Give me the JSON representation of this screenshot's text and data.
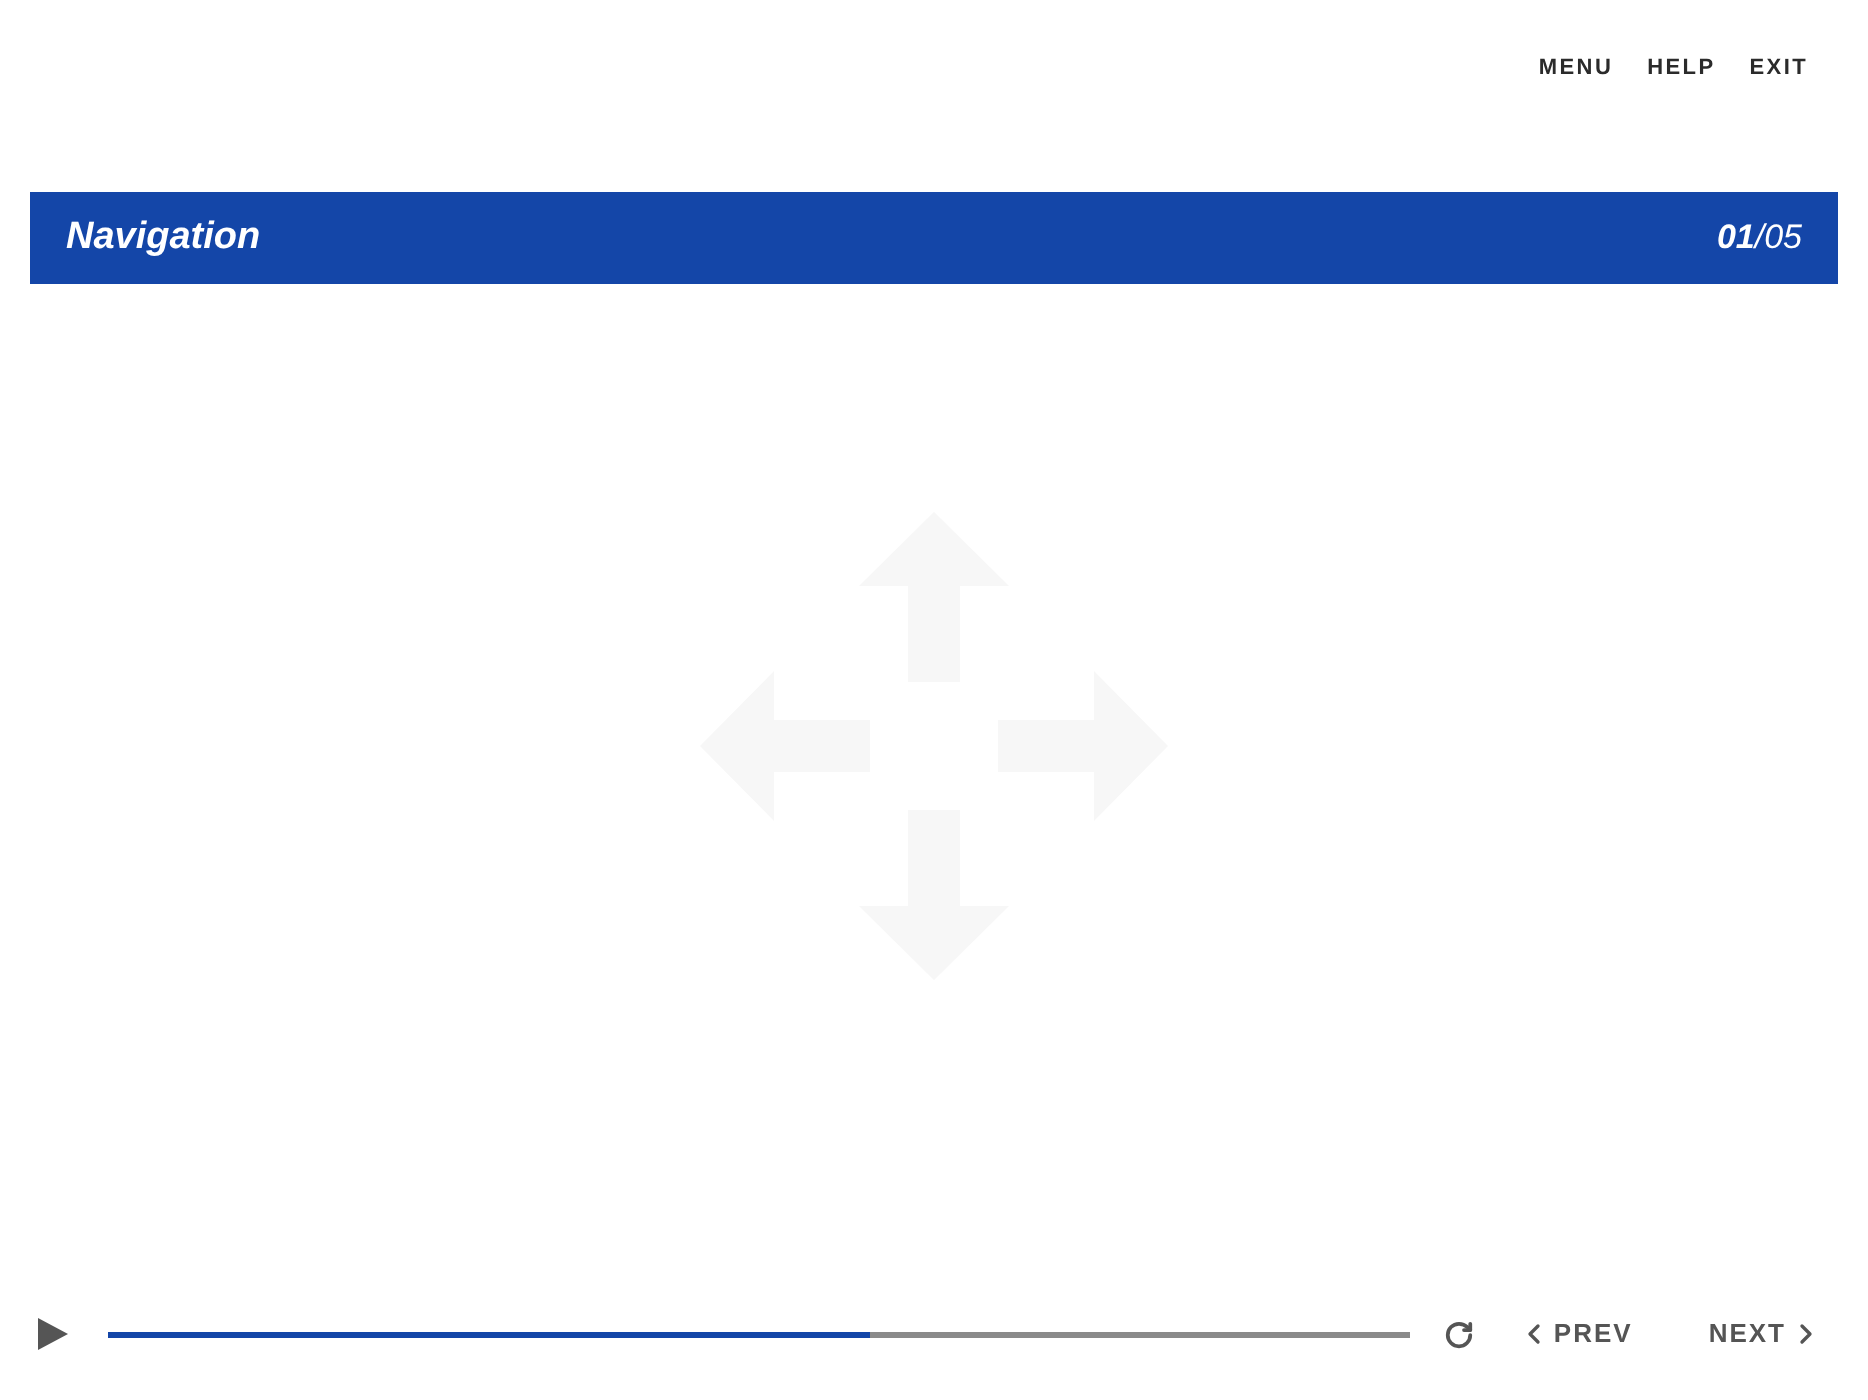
{
  "top_nav": {
    "items": [
      "MENU",
      "HELP",
      "EXIT"
    ]
  },
  "header": {
    "title": "Navigation",
    "counter": "**01**/05"
  },
  "player": {
    "playing": false,
    "progress": {
      "level": 0.586
    },
    "prev_label": "PREV",
    "next_label": "NEXT"
  }
}
